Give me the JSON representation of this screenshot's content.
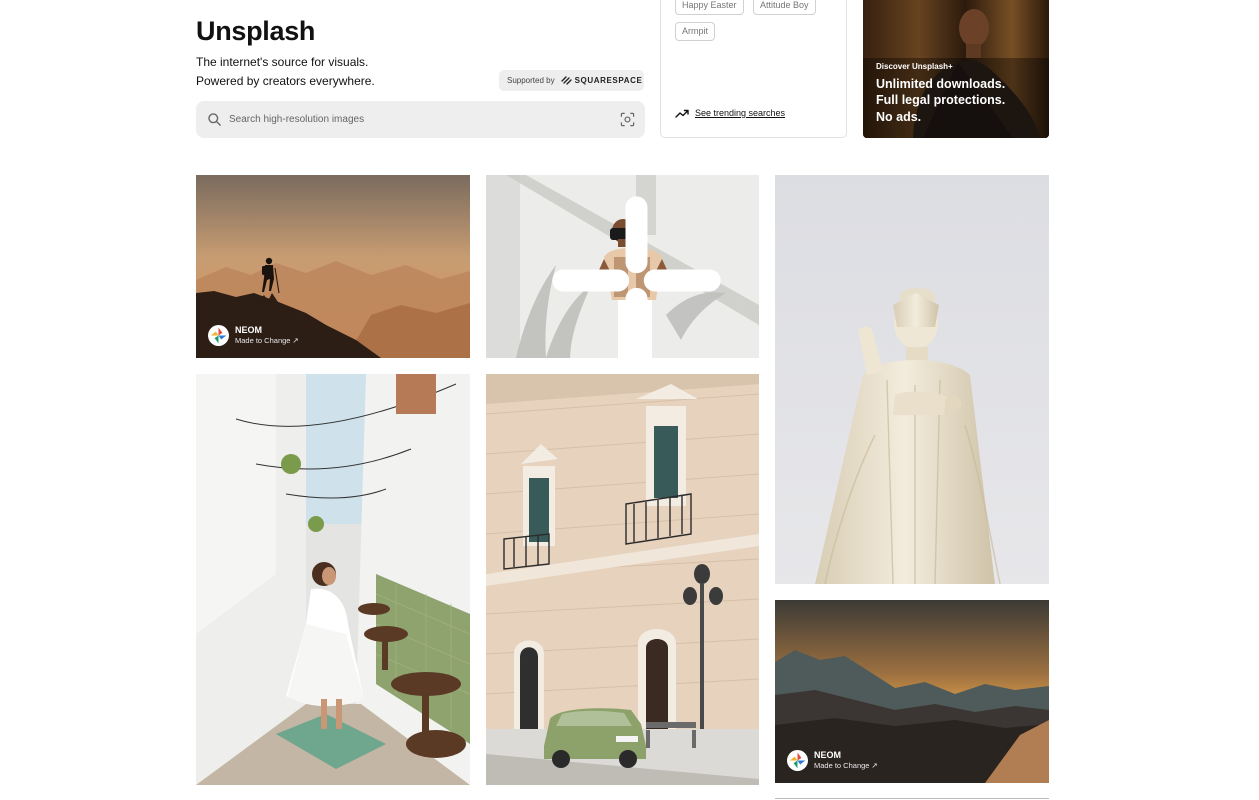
{
  "hero": {
    "title": "Unsplash",
    "tagline_line1": "The internet's source for visuals.",
    "tagline_line2": "Powered by creators everywhere.",
    "sponsor_label": "Supported by",
    "sponsor_name": "SQUARESPACE"
  },
  "search": {
    "placeholder": "Search high-resolution images",
    "value": ""
  },
  "trending": {
    "tags": [
      "Happy Easter",
      "Attitude Boy",
      "Armpit"
    ],
    "link_label": "See trending searches"
  },
  "promo": {
    "eyebrow": "Discover Unsplash+",
    "line1": "Unlimited downloads.",
    "line2": "Full legal protections.",
    "line3": "No ads."
  },
  "photos": [
    {
      "name": "hiker-desert-mountains",
      "credit_name": "NEOM",
      "credit_sub": "Made to Change ↗"
    },
    {
      "name": "vr-headset-man",
      "plus_badge": true
    },
    {
      "name": "woman-white-alley"
    },
    {
      "name": "old-building-green-car"
    },
    {
      "name": "white-buddha-statue"
    },
    {
      "name": "mountain-sunset",
      "credit_name": "NEOM",
      "credit_sub": "Made to Change ↗"
    }
  ],
  "icons": {
    "search": "search-icon",
    "visual_search": "visual-search-icon",
    "trend": "trending-arrow-icon",
    "plus": "unsplash-plus-icon"
  }
}
